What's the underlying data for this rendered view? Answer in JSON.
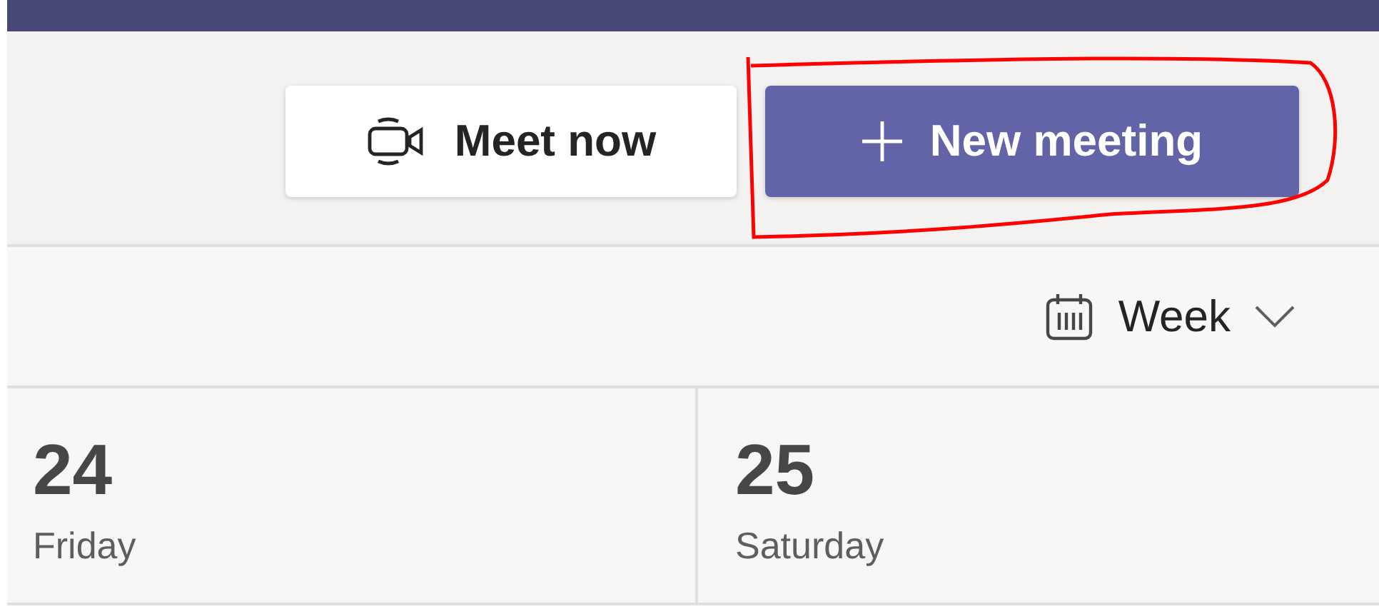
{
  "toolbar": {
    "buttons": [
      {
        "label": "Meet now",
        "kind": "secondary"
      },
      {
        "label": "New meeting",
        "kind": "primary"
      }
    ]
  },
  "view_switcher": {
    "label": "Week"
  },
  "days": [
    {
      "number": "24",
      "weekday": "Friday"
    },
    {
      "number": "25",
      "weekday": "Saturday"
    }
  ]
}
